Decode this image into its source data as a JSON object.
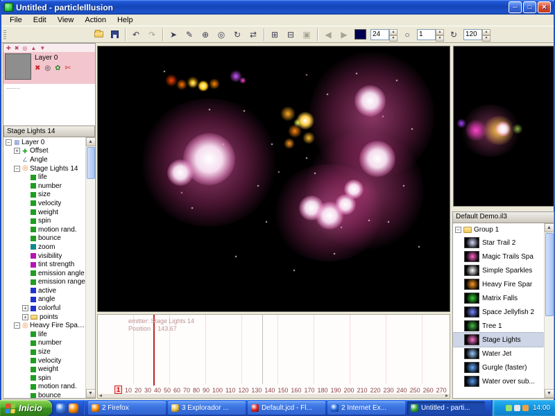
{
  "window": {
    "title": "Untitled - particleIllusion",
    "minimize": "─",
    "maximize": "□",
    "close": "✕"
  },
  "menu": {
    "items": [
      "File",
      "Edit",
      "View",
      "Action",
      "Help"
    ]
  },
  "ui": {
    "up": "▲",
    "down": "▼",
    "left": "◀",
    "right": "▶"
  },
  "toolbar": {
    "icons": {
      "undo": "↶",
      "redo": "↷",
      "select": "➤",
      "pencil": "✎",
      "add": "⊕",
      "target": "◎",
      "rotate": "↻",
      "flip": "⇄",
      "zoom_in": "⊞",
      "zoom_out": "⊟",
      "fit": "▣",
      "prev": "◀",
      "play": "▶",
      "circle": "○",
      "loop": "↻"
    },
    "frame_rate": "24",
    "current_frame": "1",
    "end_frame": "120",
    "swatch_color": "#000050"
  },
  "layers": {
    "title": "Layer 0",
    "dots": "........",
    "top_icons": [
      "✚",
      "✖",
      "◎",
      "▲",
      "▼"
    ],
    "strip_icons": [
      "✖",
      "◎",
      "✿",
      "✄"
    ]
  },
  "tree": {
    "header": "Stage Lights 14",
    "items": [
      {
        "label": "Layer 0",
        "level": 0,
        "exp": "minus",
        "icon": "#7788CC",
        "shape": "layer"
      },
      {
        "label": "Offset",
        "level": 1,
        "exp": "plus",
        "icon": "#22AA22",
        "shape": "cross"
      },
      {
        "label": "Angle",
        "level": 1,
        "icon": "#7788AA",
        "shape": "angle"
      },
      {
        "label": "Stage Lights 14",
        "level": 1,
        "exp": "minus",
        "icon": "#EE8833",
        "shape": "emitter"
      },
      {
        "label": "life",
        "level": 2,
        "icon": "#1F9E1F"
      },
      {
        "label": "number",
        "level": 2,
        "icon": "#1F9E1F"
      },
      {
        "label": "size",
        "level": 2,
        "icon": "#1F9E1F"
      },
      {
        "label": "velocity",
        "level": 2,
        "icon": "#1F9E1F"
      },
      {
        "label": "weight",
        "level": 2,
        "icon": "#1F9E1F"
      },
      {
        "label": "spin",
        "level": 2,
        "icon": "#1F9E1F"
      },
      {
        "label": "motion rand.",
        "level": 2,
        "icon": "#1F9E1F"
      },
      {
        "label": "bounce",
        "level": 2,
        "icon": "#1F9E1F"
      },
      {
        "label": "zoom",
        "level": 2,
        "icon": "#0C8A8A"
      },
      {
        "label": "visibility",
        "level": 2,
        "icon": "#B515B5"
      },
      {
        "label": "tint strength",
        "level": 2,
        "icon": "#B515B5"
      },
      {
        "label": "emission angle",
        "level": 2,
        "icon": "#1F9E1F"
      },
      {
        "label": "emission range",
        "level": 2,
        "icon": "#1F9E1F"
      },
      {
        "label": "active",
        "level": 2,
        "icon": "#2233CC"
      },
      {
        "label": "angle",
        "level": 2,
        "icon": "#2233CC"
      },
      {
        "label": "colorful",
        "level": 2,
        "exp": "plus",
        "icon": "#2233CC"
      },
      {
        "label": "points",
        "level": 2,
        "exp": "plus",
        "icon": "#E8C25A",
        "shape": "folder"
      },
      {
        "label": "Heavy Fire Sparkle",
        "level": 1,
        "exp": "minus",
        "icon": "#EE8833",
        "shape": "emitter"
      },
      {
        "label": "life",
        "level": 2,
        "icon": "#1F9E1F"
      },
      {
        "label": "number",
        "level": 2,
        "icon": "#1F9E1F"
      },
      {
        "label": "size",
        "level": 2,
        "icon": "#1F9E1F"
      },
      {
        "label": "velocity",
        "level": 2,
        "icon": "#1F9E1F"
      },
      {
        "label": "weight",
        "level": 2,
        "icon": "#1F9E1F"
      },
      {
        "label": "spin",
        "level": 2,
        "icon": "#1F9E1F"
      },
      {
        "label": "motion rand.",
        "level": 2,
        "icon": "#1F9E1F"
      },
      {
        "label": "bounce",
        "level": 2,
        "icon": "#1F9E1F"
      }
    ]
  },
  "preview": {
    "particle_colors": [
      "#FF66CC",
      "#FFFFFF",
      "#FF9900",
      "#CC44FF",
      "#FFEE66"
    ]
  },
  "timeline": {
    "emitter": "emitter: Stage Lights 14",
    "position": "Position = 143.67",
    "ruler": [
      "1",
      "10",
      "20",
      "30",
      "40",
      "50",
      "60",
      "70",
      "80",
      "90",
      "100",
      "110",
      "120",
      "130",
      "140",
      "150",
      "160",
      "170",
      "180",
      "190",
      "200",
      "210",
      "220",
      "230",
      "240",
      "250",
      "260",
      "270"
    ]
  },
  "library": {
    "header": "Default Demo.il3",
    "group": "Group 1",
    "items": [
      {
        "label": "Star Trail 2",
        "thumb": "#D8D8FF"
      },
      {
        "label": "Magic Trails Spa",
        "thumb": "#FF66CC"
      },
      {
        "label": "Simple Sparkles",
        "thumb": "#FFFFFF"
      },
      {
        "label": "Heavy Fire Spar",
        "thumb": "#FF9A22"
      },
      {
        "label": "Matrix Falls",
        "thumb": "#33CC33"
      },
      {
        "label": "Space Jellyfish 2",
        "thumb": "#7788FF"
      },
      {
        "label": "Tree 1",
        "thumb": "#44BB44"
      },
      {
        "label": "Stage Lights",
        "thumb": "#FF77CC",
        "selected": true
      },
      {
        "label": "Water Jet",
        "thumb": "#99CCFF"
      },
      {
        "label": "Gurgle (faster)",
        "thumb": "#66AAFF"
      },
      {
        "label": "Water over sub...",
        "thumb": "#5599EE"
      }
    ]
  },
  "taskbar": {
    "start": "Inicio",
    "quicklaunch": [
      "#3F7CE8",
      "#FF8A00"
    ],
    "tasks": [
      {
        "label": "2 Firefox",
        "icon": "#FF8A00"
      },
      {
        "label": "3 Explorador ...",
        "icon": "#E8C040"
      },
      {
        "label": "Default.jcd - Fl...",
        "icon": "#DD2222"
      },
      {
        "label": "2 Internet Ex...",
        "icon": "#2266DD"
      },
      {
        "label": "Untitled - parti...",
        "icon": "#33AA33",
        "active": true
      }
    ],
    "tray_icons": [
      "#9ADF6A",
      "#E8E8E8",
      "#F0A040"
    ],
    "clock": "14:00"
  }
}
